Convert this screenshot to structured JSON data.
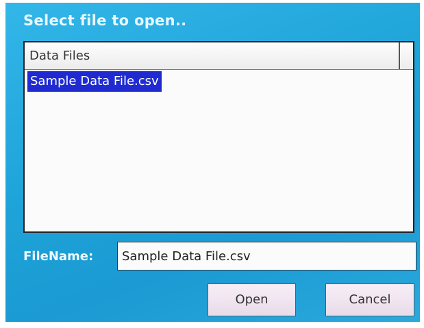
{
  "dialog": {
    "title": "Select file to open.."
  },
  "file_list": {
    "column_header": "Data Files",
    "items": [
      {
        "name": "Sample Data File.csv",
        "selected": true
      }
    ]
  },
  "filename": {
    "label": "FileName:",
    "value": "Sample Data File.csv"
  },
  "buttons": {
    "open_label": "Open",
    "cancel_label": "Cancel"
  },
  "colors": {
    "background_accent": "#1ea3d8",
    "selection": "#1f2bd0"
  }
}
